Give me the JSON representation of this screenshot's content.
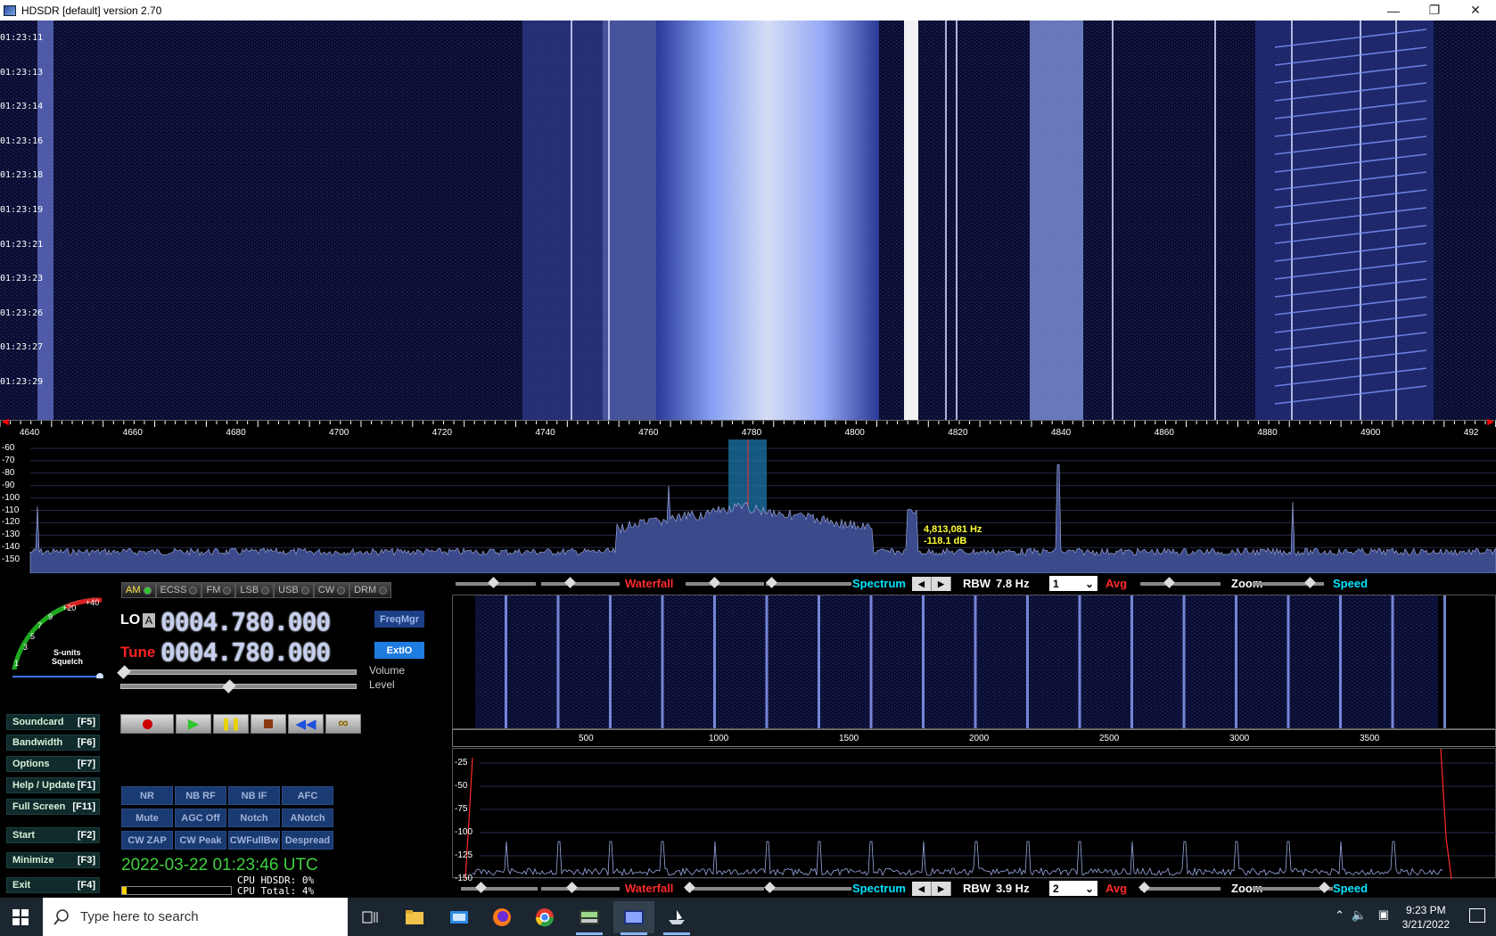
{
  "window": {
    "title": "HDSDR [default]  version 2.70"
  },
  "waterfall_top": {
    "times": [
      "01:23:11",
      "01:23:13",
      "01:23:14",
      "01:23:16",
      "01:23:18",
      "01:23:19",
      "01:23:21",
      "01:23:23",
      "01:23:26",
      "01:23:27",
      "01:23:29"
    ],
    "freq_ticks": [
      "4640",
      "4660",
      "4680",
      "4700",
      "4720",
      "4740",
      "4760",
      "4780",
      "4800",
      "4820",
      "4840",
      "4860",
      "4880",
      "4900",
      "492"
    ]
  },
  "spectrum_top": {
    "db_ticks": [
      "-60",
      "-70",
      "-80",
      "-90",
      "-100",
      "-110",
      "-120",
      "-130",
      "-140",
      "-150"
    ],
    "marker_freq": "4,813,081 Hz",
    "marker_level": "-118.1 dB"
  },
  "modes": [
    {
      "label": "AM",
      "active": true
    },
    {
      "label": "ECSS",
      "active": false
    },
    {
      "label": "FM",
      "active": false
    },
    {
      "label": "LSB",
      "active": false
    },
    {
      "label": "USB",
      "active": false
    },
    {
      "label": "CW",
      "active": false
    },
    {
      "label": "DRM",
      "active": false
    }
  ],
  "smeter": {
    "scale": [
      "1",
      "3",
      "5",
      "7",
      "9",
      "+20",
      "+40"
    ],
    "label1": "S-units",
    "label2": "Squelch"
  },
  "lo": {
    "label": "LO",
    "badge": "A",
    "value": "0004.780.000"
  },
  "tune": {
    "label": "Tune",
    "value": "0004.780.000"
  },
  "buttons": {
    "freqmgr": "FreqMgr",
    "extio": "ExtIO",
    "volume": "Volume",
    "level": "Level"
  },
  "fn_buttons": [
    {
      "label": "Soundcard",
      "key": "[F5]"
    },
    {
      "label": "Bandwidth",
      "key": "[F6]"
    },
    {
      "label": "Options",
      "key": "[F7]"
    },
    {
      "label": "Help / Update",
      "key": "[F1]"
    },
    {
      "label": "Full Screen",
      "key": "[F11]"
    },
    {
      "label": "Start",
      "key": "[F2]"
    },
    {
      "label": "Minimize",
      "key": "[F3]"
    },
    {
      "label": "Exit",
      "key": "[F4]"
    }
  ],
  "dsp": [
    "NR",
    "NB RF",
    "NB IF",
    "AFC",
    "Mute",
    "AGC Off",
    "Notch",
    "ANotch",
    "CW ZAP",
    "CW Peak",
    "CWFullBw",
    "Despread"
  ],
  "status": {
    "datetime": "2022-03-22   01:23:46 UTC",
    "cpu_hdsdr": "CPU HDSDR:  0%",
    "cpu_total": "CPU Total:  4%",
    "cpu_total_fraction": 0.04
  },
  "rf_strip": {
    "waterfall": "Waterfall",
    "spectrum": "Spectrum",
    "rbw_label": "RBW",
    "rbw_value": "7.8 Hz",
    "avg_value": "1",
    "avg_label": "Avg",
    "zoom": "Zoom",
    "speed": "Speed"
  },
  "af_strip": {
    "waterfall": "Waterfall",
    "spectrum": "Spectrum",
    "rbw_label": "RBW",
    "rbw_value": "3.9 Hz",
    "avg_value": "2",
    "avg_label": "Avg",
    "zoom": "Zoom",
    "speed": "Speed"
  },
  "af_axis": {
    "ticks": [
      "500",
      "1000",
      "1500",
      "2000",
      "2500",
      "3000",
      "3500"
    ]
  },
  "af_spec": {
    "db_ticks": [
      "-25",
      "-50",
      "-75",
      "-100",
      "-125",
      "-150"
    ]
  },
  "taskbar": {
    "search_placeholder": "Type here to search",
    "time": "9:23 PM",
    "date": "3/21/2022"
  },
  "colors": {
    "waterfall_bg": "#06081e",
    "spectrum_fill": "#3a4a8a",
    "accent_cyan": "#00e5ff",
    "accent_red": "#ff2222",
    "datetime_green": "#3fd03f"
  }
}
